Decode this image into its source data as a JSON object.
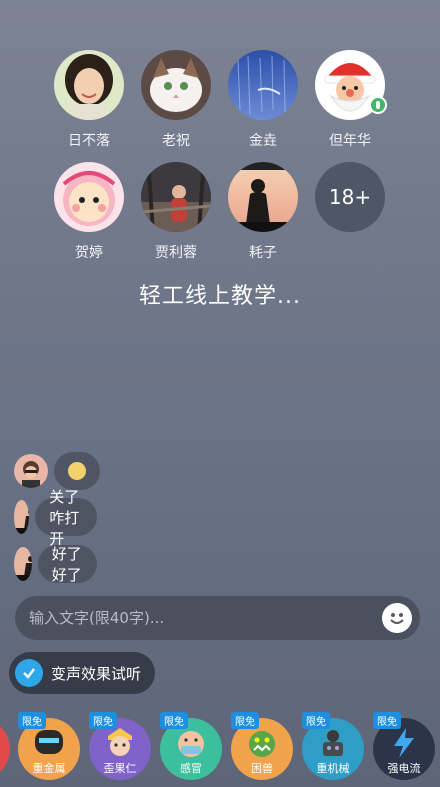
{
  "participants": [
    {
      "name": "日不落"
    },
    {
      "name": "老祝"
    },
    {
      "name": "金垚"
    },
    {
      "name": "但年华",
      "speaking": true
    },
    {
      "name": "贺婷"
    },
    {
      "name": "贾利蓉"
    },
    {
      "name": "耗子"
    }
  ],
  "more_count": "18+",
  "room_title": "轻工线上教学...",
  "chat": [
    {
      "text": ""
    },
    {
      "text": "关了咋打开"
    },
    {
      "text": "好了好了"
    }
  ],
  "input": {
    "placeholder": "输入文字(限40字)..."
  },
  "voice_effect_toggle": {
    "label": "变声效果试听",
    "checked": true
  },
  "voice_effects": [
    {
      "name": "重金属",
      "tag": "限免",
      "color": "#f0a34b"
    },
    {
      "name": "歪果仁",
      "tag": "限免",
      "color": "#7f63c9"
    },
    {
      "name": "感冒",
      "tag": "限免",
      "color": "#3bbf9d"
    },
    {
      "name": "困兽",
      "tag": "限免",
      "color": "#f0a34b"
    },
    {
      "name": "重机械",
      "tag": "限免",
      "color": "#2f9ec6"
    },
    {
      "name": "强电流",
      "tag": "限免",
      "color": "#2b3448"
    }
  ]
}
